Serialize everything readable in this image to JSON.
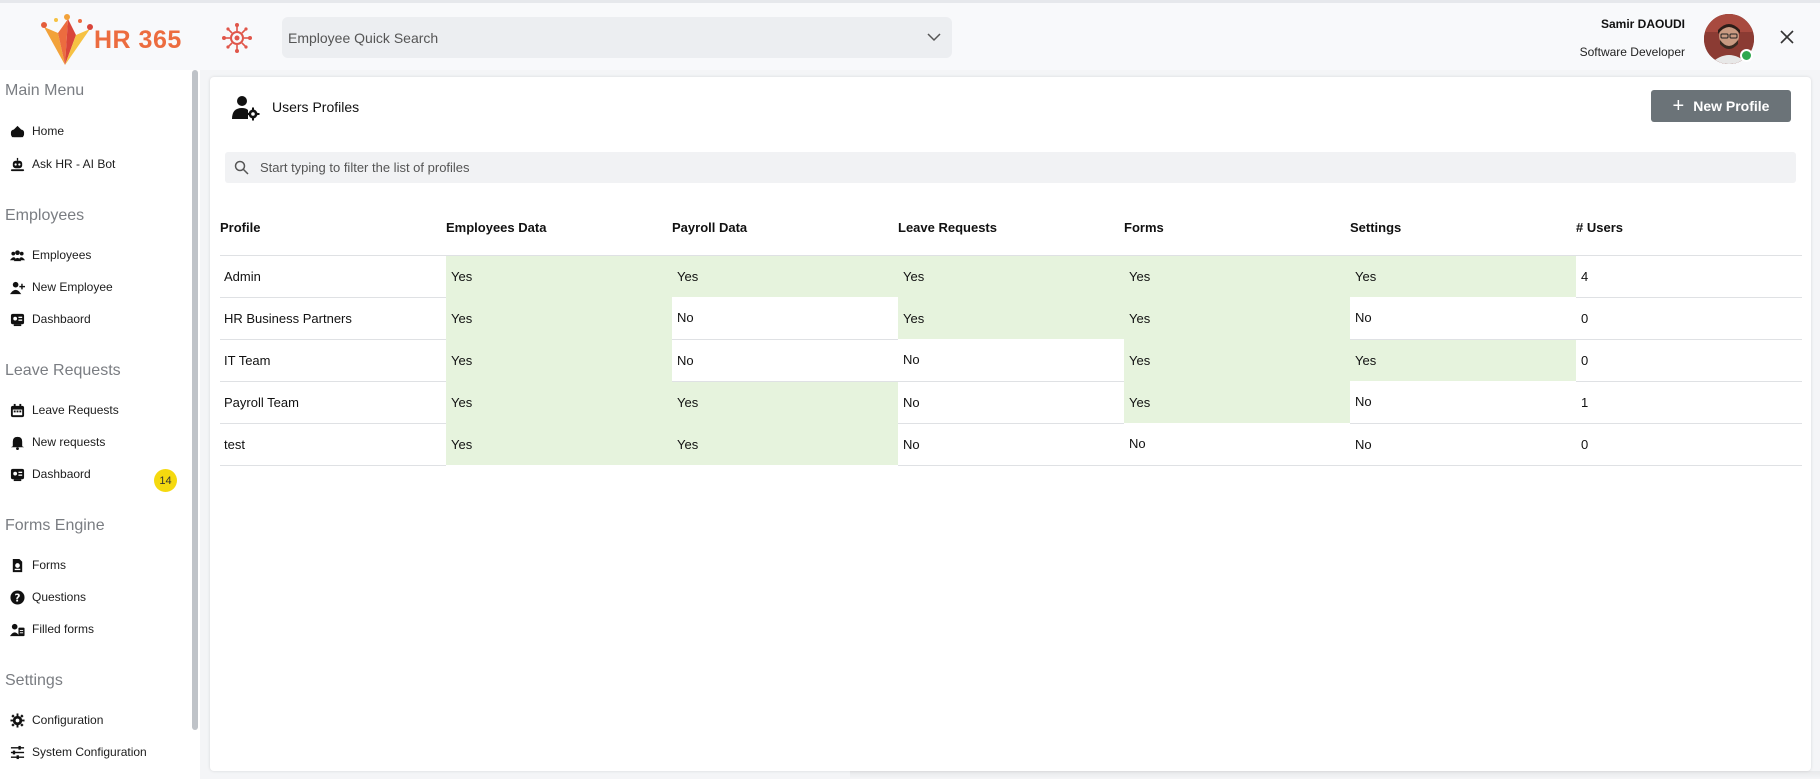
{
  "header": {
    "logo_text": "HR 365",
    "search_placeholder": "Employee Quick Search",
    "user_name": "Samir DAOUDI",
    "user_role": "Software Developer"
  },
  "sidebar": {
    "sections": [
      {
        "title": "Main Menu",
        "items": [
          {
            "label": "Home",
            "icon": "home-icon"
          },
          {
            "label": "Ask HR - AI Bot",
            "icon": "robot-icon"
          }
        ]
      },
      {
        "title": "Employees",
        "items": [
          {
            "label": "Employees",
            "icon": "users-icon"
          },
          {
            "label": "New Employee",
            "icon": "user-plus-icon"
          },
          {
            "label": "Dashbaord",
            "icon": "dashboard-icon"
          }
        ]
      },
      {
        "title": "Leave Requests",
        "items": [
          {
            "label": "Leave Requests",
            "icon": "calendar-icon",
            "badge": "14"
          },
          {
            "label": "New requests",
            "icon": "bell-icon"
          },
          {
            "label": "Dashbaord",
            "icon": "dashboard-icon"
          }
        ]
      },
      {
        "title": "Forms Engine",
        "items": [
          {
            "label": "Forms",
            "icon": "form-icon"
          },
          {
            "label": "Questions",
            "icon": "question-icon"
          },
          {
            "label": "Filled forms",
            "icon": "user-file-icon"
          }
        ]
      },
      {
        "title": "Settings",
        "items": [
          {
            "label": "Configuration",
            "icon": "gear-icon"
          },
          {
            "label": "System Configuration",
            "icon": "sliders-icon"
          }
        ]
      }
    ]
  },
  "main": {
    "title": "Users Profiles",
    "new_profile_label": "New Profile",
    "filter_placeholder": "Start typing to filter the list of profiles",
    "columns": [
      "Profile",
      "Employees Data",
      "Payroll Data",
      "Leave Requests",
      "Forms",
      "Settings",
      "# Users"
    ],
    "rows": [
      [
        "Admin",
        "Yes",
        "Yes",
        "Yes",
        "Yes",
        "Yes",
        "4"
      ],
      [
        "HR Business Partners",
        "Yes",
        "No",
        "Yes",
        "Yes",
        "No",
        "0"
      ],
      [
        "IT Team",
        "Yes",
        "No",
        "No",
        "Yes",
        "Yes",
        "0"
      ],
      [
        "Payroll Team",
        "Yes",
        "Yes",
        "No",
        "Yes",
        "No",
        "1"
      ],
      [
        "test",
        "Yes",
        "Yes",
        "No",
        "No",
        "No",
        "0"
      ]
    ]
  },
  "colors": {
    "accent": "#ec6c3f",
    "yes_cell": "#e6f3dd",
    "button": "#6b7378",
    "badge": "#f5d90f",
    "online": "#2fa84f"
  }
}
